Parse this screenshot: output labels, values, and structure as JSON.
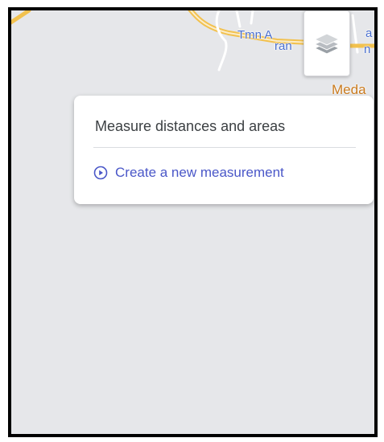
{
  "map": {
    "labels": {
      "town_line1": "Tmn A",
      "town_line2": "ran",
      "side_a": "a",
      "side_n": "n",
      "place": "Meda",
      "side_a2": "a"
    },
    "road_color": "#f2c14e",
    "background_color": "#e6e7ea"
  },
  "layers_button": {
    "icon": "layers-icon"
  },
  "measure_panel": {
    "title": "Measure distances and areas",
    "action_label": "Create a new measurement",
    "action_icon": "play-circle-icon",
    "accent_color": "#4a57c8"
  }
}
